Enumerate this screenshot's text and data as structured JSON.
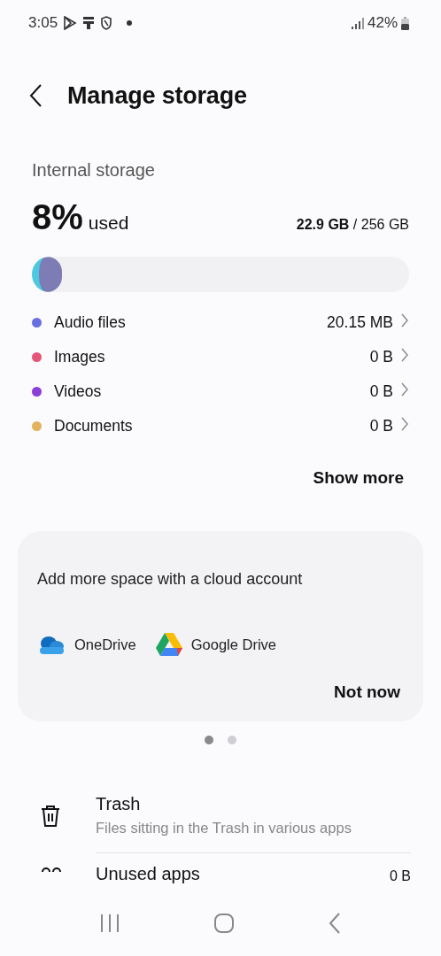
{
  "status_bar": {
    "time": "3:05",
    "battery": "42%"
  },
  "header": {
    "title": "Manage storage"
  },
  "storage": {
    "label": "Internal storage",
    "percent": "8%",
    "used_label": "used",
    "used": "22.9 GB",
    "total": "/ 256 GB",
    "usage_bar": {
      "level": 0.08
    }
  },
  "categories": [
    {
      "name": "Audio files",
      "size": "20.15 MB",
      "color": "#6a6fe0"
    },
    {
      "name": "Images",
      "size": "0 B",
      "color": "#e4557a"
    },
    {
      "name": "Videos",
      "size": "0 B",
      "color": "#8a3fd6"
    },
    {
      "name": "Documents",
      "size": "0 B",
      "color": "#e2b25e"
    }
  ],
  "show_more": "Show more",
  "cloud_card": {
    "message": "Add more space with a cloud account",
    "services": [
      {
        "kind": "onedrive",
        "label": "OneDrive"
      },
      {
        "kind": "gdrive",
        "label": "Google Drive"
      }
    ],
    "dismiss": "Not now"
  },
  "pager": [
    {
      "selected": true
    },
    {
      "selected": false
    }
  ],
  "items": [
    {
      "kind": "trash",
      "title": "Trash",
      "subtitle": "Files sitting in the Trash in various apps"
    },
    {
      "kind": "apps",
      "title": "Unused apps",
      "value": "0 B"
    }
  ]
}
